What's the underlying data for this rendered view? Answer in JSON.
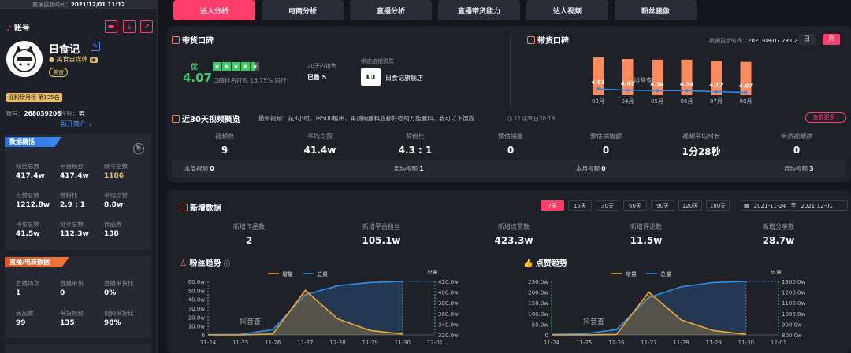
{
  "left": {
    "update_time_label": "数据更新时间：",
    "update_time": "2021/12/01 11:12",
    "account_label": "账号",
    "name": "日食记",
    "media_tag": "美食自媒体",
    "category_tag": "美食",
    "rank_badge": "涨粉榜月榜 第135名",
    "account_no_label": "账号：",
    "account_no": "268039206",
    "gender_label": "性别：",
    "gender": "男",
    "expand_label": "展开简介",
    "overview": {
      "title": "数据概括",
      "cells": [
        {
          "label": "粉丝总数",
          "value": "417.4w"
        },
        {
          "label": "平台粉丝",
          "value": "417.4w"
        },
        {
          "label": "账号指数",
          "value": "1186",
          "highlight": true
        },
        {
          "label": "点赞总数",
          "value": "1212.8w"
        },
        {
          "label": "赞粉比",
          "value": "2.9 : 1"
        },
        {
          "label": "平均点赞",
          "value": "8.8w"
        },
        {
          "label": "评论总数",
          "value": "41.5w"
        },
        {
          "label": "分享总数",
          "value": "112.3w"
        },
        {
          "label": "作品数",
          "value": "138"
        }
      ]
    },
    "live": {
      "title": "直播/电商数据",
      "cells": [
        {
          "label": "直播场次",
          "value": "1"
        },
        {
          "label": "直播带货",
          "value": "0"
        },
        {
          "label": "直播带货比",
          "value": "0%"
        },
        {
          "label": "商品数",
          "value": "99"
        },
        {
          "label": "带货视频",
          "value": "135"
        },
        {
          "label": "视频带货比",
          "value": "98%"
        }
      ]
    }
  },
  "tabs": [
    "达人分析",
    "电商分析",
    "直播分析",
    "直播带货能力",
    "达人视频",
    "粉丝画像"
  ],
  "reputation": {
    "title": "带货口碑",
    "grade": "优",
    "score": "4.07",
    "rank_text": "口碑排名打败 13.75% 同行",
    "sales_label": "30天内销售",
    "sales_value": "已售 5",
    "shop_label": "绑定店铺资质",
    "shop_name": "日食记旗舰店"
  },
  "reputation_chart": {
    "title": "带货口碑",
    "update_label": "数据更新时间：",
    "update_time": "2021-08-07 23:02",
    "day_btn": "日",
    "month_btn": "月"
  },
  "chart_data": [
    {
      "type": "bar",
      "title": "带货口碑",
      "categories": [
        "03月",
        "04月",
        "05月",
        "06月",
        "07月",
        "08月"
      ],
      "values": [
        4.61,
        4.42,
        4.34,
        4.34,
        4.17,
        4.07
      ],
      "ylim": [
        0,
        5
      ]
    },
    {
      "type": "line",
      "title": "粉丝趋势",
      "x": [
        "11-24",
        "11-25",
        "11-26",
        "11-27",
        "11-28",
        "11-29",
        "11-30",
        "12-01"
      ],
      "series": [
        {
          "name": "增量",
          "values": [
            0,
            0,
            1,
            50,
            18,
            5,
            1,
            null
          ]
        },
        {
          "name": "总量",
          "values": [
            320.5,
            321,
            330,
            395,
            412,
            418,
            420,
            420
          ]
        }
      ],
      "left_axis": {
        "label": "",
        "ticks": [
          "0",
          "10.0w",
          "20.0w",
          "30.0w",
          "40.0w",
          "50.0w",
          "60.0w"
        ],
        "ylim": [
          0,
          60
        ]
      },
      "right_axis": {
        "label": "总量",
        "ticks": [
          "320.0w",
          "340.0w",
          "360.0w",
          "380.0w",
          "400.0w",
          "420.0w"
        ],
        "ylim": [
          320,
          420
        ]
      }
    },
    {
      "type": "line",
      "title": "点赞趋势",
      "x": [
        "11-24",
        "11-25",
        "11-26",
        "11-27",
        "11-28",
        "11-29",
        "11-30",
        "12-01"
      ],
      "series": [
        {
          "name": "增量",
          "values": [
            0,
            0,
            2,
            200,
            70,
            20,
            3,
            null
          ]
        },
        {
          "name": "总量",
          "values": [
            805,
            810,
            850,
            1150,
            1250,
            1290,
            1300,
            1300
          ]
        }
      ],
      "left_axis": {
        "label": "",
        "ticks": [
          "0",
          "50.0w",
          "100.0w",
          "150.0w",
          "200.0w",
          "250.0w"
        ],
        "ylim": [
          0,
          250
        ]
      },
      "right_axis": {
        "label": "总量",
        "ticks": [
          "800.0w",
          "900.0w",
          "1000.0w",
          "1100.0w",
          "1200.0w",
          "1300.0w"
        ],
        "ylim": [
          800,
          1300
        ]
      }
    }
  ],
  "video30": {
    "title": "近30天视频概览",
    "latest_label": "最新视频：花3小时，串500根串，再调碗蘸料底都好吃的万能蘸料，我可以下馊揽...",
    "latest_date": "11月26日20:18",
    "more_btn": "查看更多",
    "stats": [
      {
        "label": "视频数",
        "value": "9"
      },
      {
        "label": "平均点赞",
        "value": "41.4w"
      },
      {
        "label": "赞粉比",
        "value": "4.3 : 1"
      },
      {
        "label": "预估销量",
        "value": "0"
      },
      {
        "label": "预估销售额",
        "value": "0"
      },
      {
        "label": "视频平均时长",
        "value": "1分28秒"
      },
      {
        "label": "带货视频数",
        "value": "0"
      }
    ],
    "freq": [
      {
        "label": "本周视频",
        "value": "0"
      },
      {
        "label": "周均视频",
        "value": "1"
      },
      {
        "label": "本月视频",
        "value": "0"
      },
      {
        "label": "月均视频",
        "value": "3"
      }
    ]
  },
  "newdata": {
    "title": "新增数据",
    "ranges": [
      "7天",
      "15天",
      "30天",
      "60天",
      "90天",
      "120天",
      "180天"
    ],
    "date_from": "2021-11-24",
    "date_sep": "至",
    "date_to": "2021-12-01",
    "stats": [
      {
        "label": "新增作品数",
        "value": "2"
      },
      {
        "label": "新增平台粉丝",
        "value": "105.1w"
      },
      {
        "label": "新增点赞数",
        "value": "423.3w"
      },
      {
        "label": "新增评论数",
        "value": "11.5w"
      },
      {
        "label": "新增分享数",
        "value": "28.7w"
      }
    ],
    "fans_title": "粉丝趋势",
    "likes_title": "点赞趋势",
    "legend_inc": "增量",
    "legend_total": "总量",
    "watermark": "抖音查"
  },
  "colors": {
    "accent": "#ff3d6b",
    "bar": "#ff8a5c",
    "line": "#2f8fe6",
    "inc": "#f0a830",
    "card": "#1f2129"
  }
}
